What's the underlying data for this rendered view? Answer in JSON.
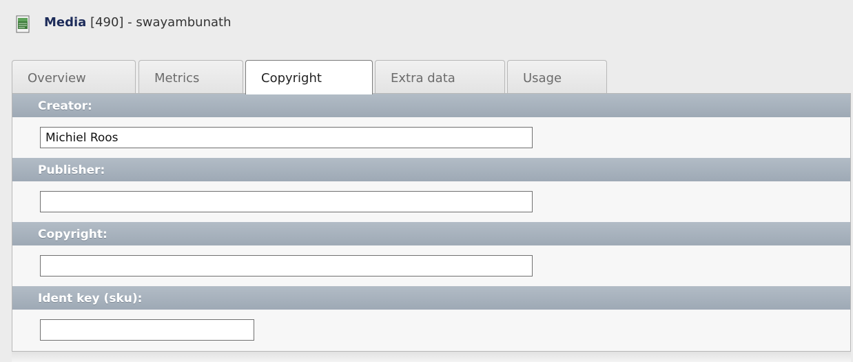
{
  "header": {
    "icon": "document-icon",
    "title_bold": "Media",
    "title_rest": " [490] - swayambunath"
  },
  "tabs": [
    {
      "label": "Overview",
      "active": false
    },
    {
      "label": "Metrics",
      "active": false
    },
    {
      "label": "Copyright",
      "active": true
    },
    {
      "label": "Extra data",
      "active": false
    },
    {
      "label": "Usage",
      "active": false
    }
  ],
  "fields": {
    "creator": {
      "label": "Creator:",
      "value": "Michiel Roos"
    },
    "publisher": {
      "label": "Publisher:",
      "value": ""
    },
    "copyright": {
      "label": "Copyright:",
      "value": ""
    },
    "ident_key": {
      "label": "Ident key (sku):",
      "value": ""
    }
  },
  "colors": {
    "section_header": "#a8b2bd",
    "title_accent": "#1d2c5a",
    "background": "#ececec"
  }
}
